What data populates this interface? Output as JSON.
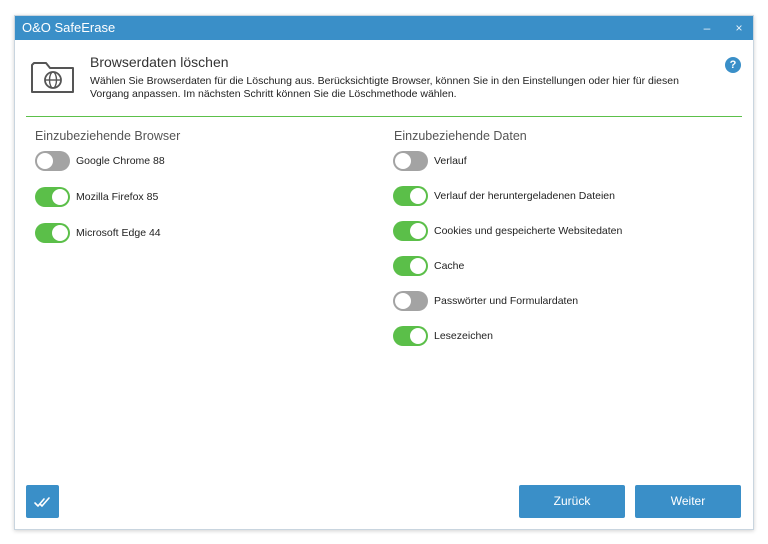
{
  "window": {
    "title": "O&O SafeErase",
    "minimize_glyph": "–",
    "close_glyph": "×"
  },
  "header": {
    "title": "Browserdaten löschen",
    "description": "Wählen Sie Browserdaten für die Löschung aus. Berücksichtigte Browser, können Sie in den Einstellungen oder hier für diesen Vorgang anpassen. Im nächsten Schritt können Sie die Löschmethode wählen.",
    "help_glyph": "?",
    "icon": "browser-folder-icon"
  },
  "browsers": {
    "title": "Einzubeziehende Browser",
    "items": [
      {
        "label": "Google Chrome 88",
        "enabled": false
      },
      {
        "label": "Mozilla Firefox 85",
        "enabled": true
      },
      {
        "label": "Microsoft Edge 44",
        "enabled": true
      }
    ]
  },
  "data_types": {
    "title": "Einzubeziehende Daten",
    "items": [
      {
        "label": "Verlauf",
        "enabled": false
      },
      {
        "label": "Verlauf der heruntergeladenen Dateien",
        "enabled": true
      },
      {
        "label": "Cookies und gespeicherte Websitedaten",
        "enabled": true
      },
      {
        "label": "Cache",
        "enabled": true
      },
      {
        "label": "Passwörter und Formulardaten",
        "enabled": false
      },
      {
        "label": "Lesezeichen",
        "enabled": true
      }
    ]
  },
  "footer": {
    "check_icon": "double-check-icon",
    "back_label": "Zurück",
    "next_label": "Weiter"
  },
  "colors": {
    "accent": "#3a8fc8",
    "toggle_on": "#5bbf49",
    "toggle_off": "#a3a3a3",
    "divider": "#5cc04a"
  }
}
